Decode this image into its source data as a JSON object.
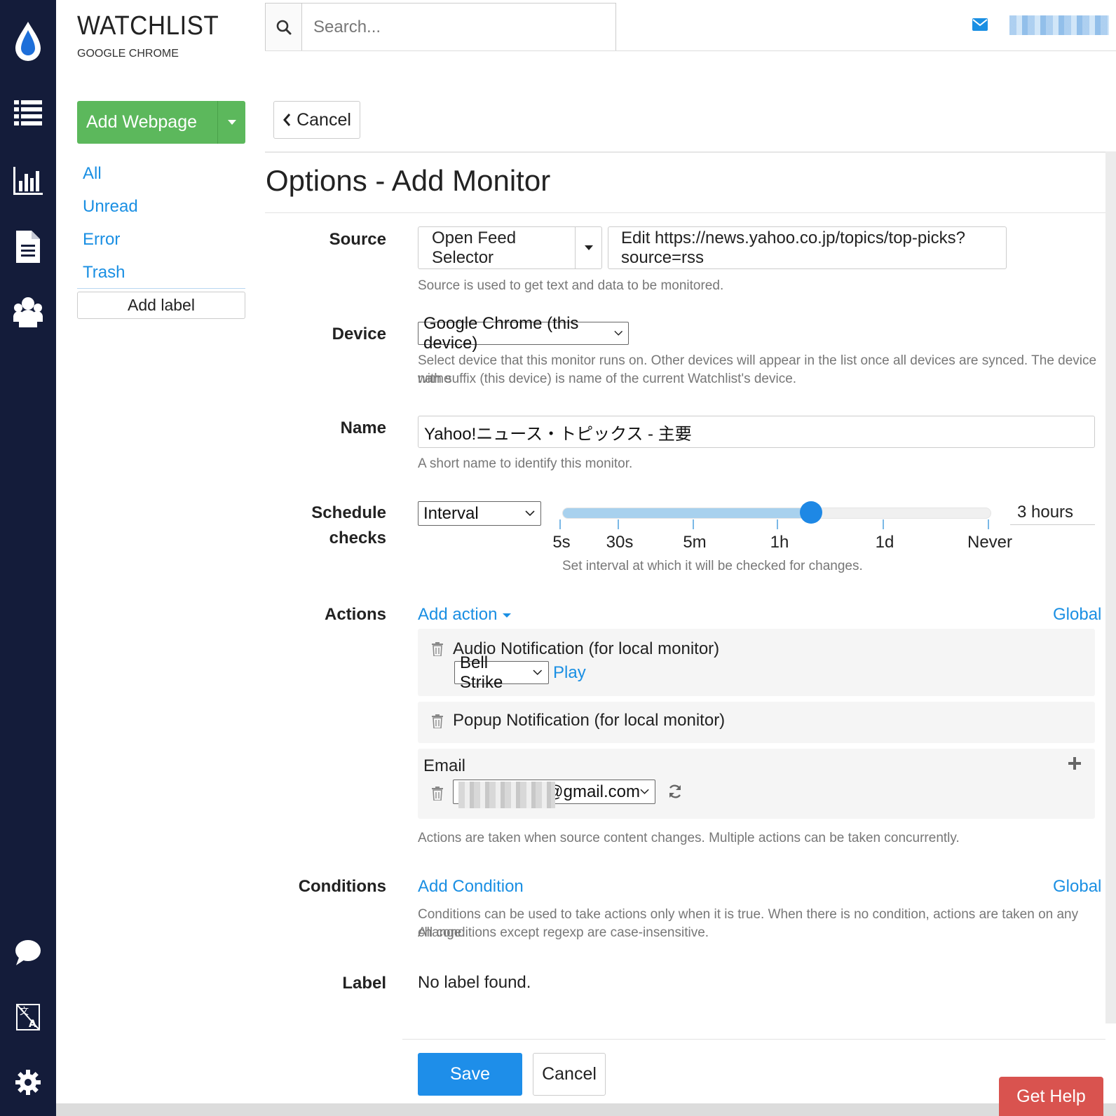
{
  "app": {
    "title": "WATCHLIST",
    "subtitle": "GOOGLE CHROME"
  },
  "search": {
    "placeholder": "Search..."
  },
  "sidebar": {
    "add_webpage": "Add Webpage",
    "links": [
      "All",
      "Unread",
      "Error",
      "Trash"
    ],
    "add_label": "Add label"
  },
  "toolbar": {
    "cancel_label": "Cancel"
  },
  "page": {
    "title": "Options - Add Monitor"
  },
  "form": {
    "source": {
      "label": "Source",
      "selector_button": "Open Feed Selector",
      "edit_button": "Edit https://news.yahoo.co.jp/topics/top-picks?source=rss",
      "help": "Source is used to get text and data to be monitored."
    },
    "device": {
      "label": "Device",
      "value": "Google Chrome (this device)",
      "help1": "Select device that this monitor runs on. Other devices will appear in the list once all devices are synced. The device name",
      "help2": "with suffix (this device) is name of the current Watchlist's device."
    },
    "name": {
      "label": "Name",
      "value": "Yahoo!ニュース・トピックス - 主要",
      "help": "A short name to identify this monitor."
    },
    "schedule": {
      "label1": "Schedule",
      "label2": "checks",
      "mode": "Interval",
      "ticks": [
        "5s",
        "30s",
        "5m",
        "1h",
        "1d",
        "Never"
      ],
      "value_fraction": 0.58,
      "value_text": "3 hours",
      "help": "Set interval at which it will be checked for changes."
    },
    "actions": {
      "label": "Actions",
      "add_action": "Add action",
      "global": "Global",
      "audio_title": "Audio Notification (for local monitor)",
      "audio_sound": "Bell Strike",
      "play": "Play",
      "popup_title": "Popup Notification (for local monitor)",
      "email_title": "Email",
      "email_suffix": "@gmail.com",
      "help": "Actions are taken when source content changes. Multiple actions can be taken concurrently."
    },
    "conditions": {
      "label": "Conditions",
      "add_condition": "Add Condition",
      "global": "Global",
      "help1": "Conditions can be used to take actions only when it is true. When there is no condition, actions are taken on any change.",
      "help2": "All conditions except regexp are case-insensitive."
    },
    "label_field": {
      "label": "Label",
      "value": "No label found."
    }
  },
  "footer": {
    "save": "Save",
    "cancel": "Cancel",
    "get_help": "Get Help"
  },
  "icons": {
    "rail": [
      "logo-drop-icon",
      "list-icon",
      "bar-chart-icon",
      "document-icon",
      "users-icon",
      "chat-icon",
      "translate-icon",
      "gear-icon"
    ],
    "accent": "#1a8fe3",
    "primary_green": "#5cb85c",
    "danger": "#d9534f"
  }
}
